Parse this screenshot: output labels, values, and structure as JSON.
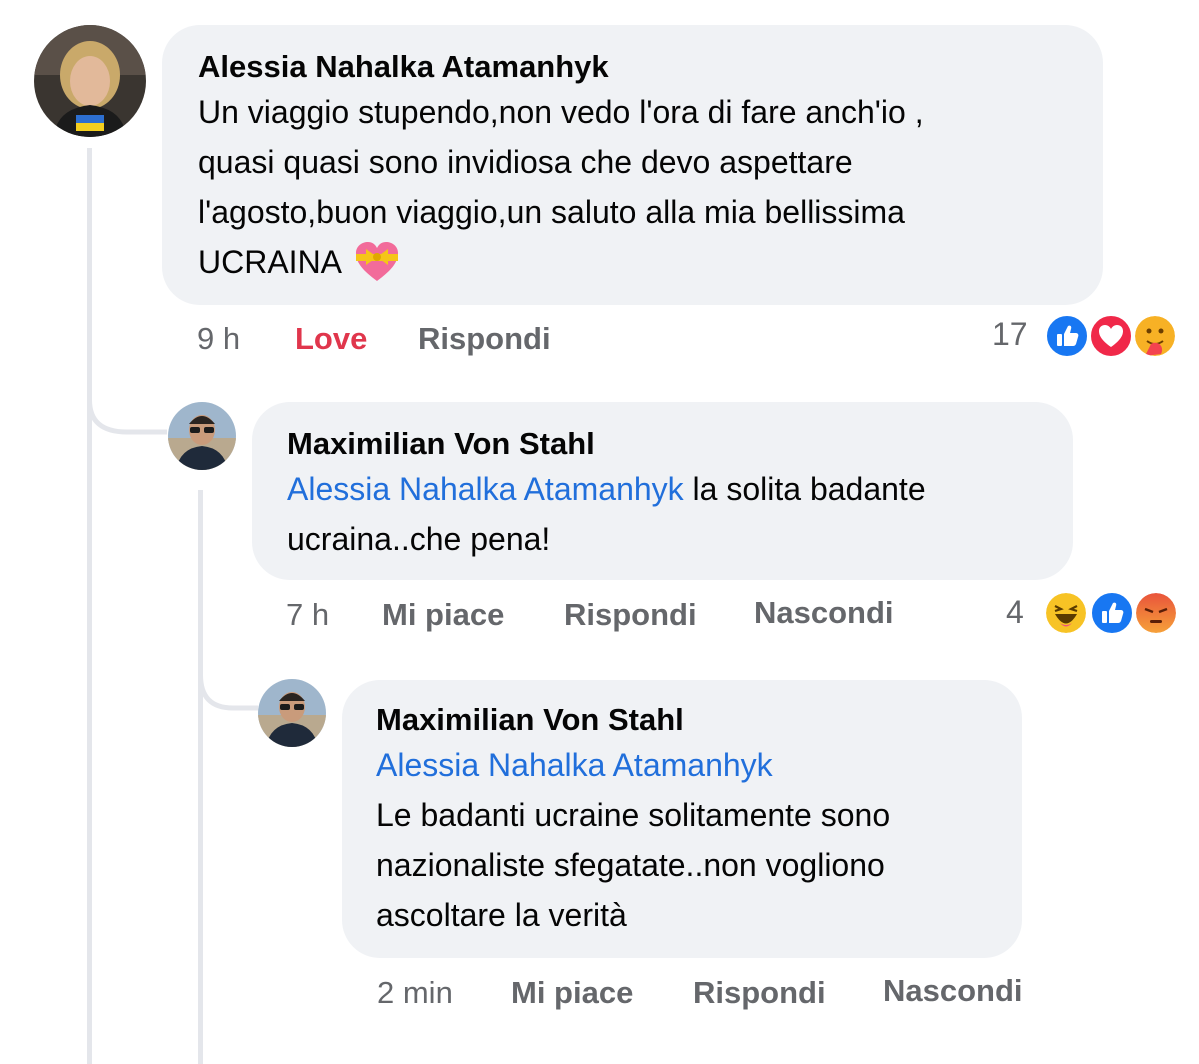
{
  "colors": {
    "bubble": "#f0f2f5",
    "meta_gray": "#65676b",
    "love_red": "#e0364c",
    "mention_blue": "#216fdb",
    "like_blue": "#1877f2"
  },
  "comments": [
    {
      "author": "Alessia Nahalka Atamanhyk",
      "text_lines": [
        "Un viaggio stupendo,non vedo l'ora di fare anch'io ,",
        "quasi quasi sono invidiosa che devo aspettare",
        "l'agosto,buon viaggio,un saluto alla mia bellissima",
        "UCRAINA"
      ],
      "emoji": "heart-with-ribbon",
      "time": "9 h",
      "reaction_label": "Love",
      "reply_label": "Rispondi",
      "reaction_count": "17",
      "reaction_icons": [
        "like-icon",
        "love-icon",
        "care-icon"
      ]
    },
    {
      "author": "Maximilian Von Stahl",
      "mention": "Alessia Nahalka Atamanhyk",
      "text_after_mention": " la solita badante",
      "text_line2": "ucraina..che pena!",
      "time": "7 h",
      "like_label": "Mi piace",
      "reply_label": "Rispondi",
      "hide_label": "Nascondi",
      "reaction_count": "4",
      "reaction_icons": [
        "haha-icon",
        "like-icon",
        "angry-icon"
      ]
    },
    {
      "author": "Maximilian Von Stahl",
      "mention": "Alessia Nahalka Atamanhyk",
      "text_lines": [
        "Le badanti ucraine solitamente sono",
        "nazionaliste sfegatate..non vogliono",
        "ascoltare la verità"
      ],
      "time": "2 min",
      "like_label": "Mi piace",
      "reply_label": "Rispondi",
      "hide_label": "Nascondi"
    }
  ]
}
